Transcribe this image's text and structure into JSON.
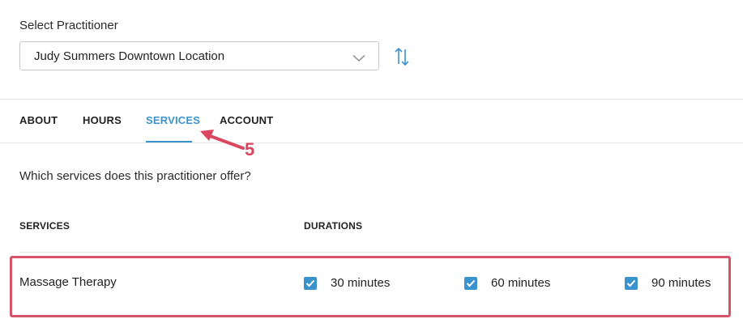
{
  "practitioner": {
    "label": "Select Practitioner",
    "selected": "Judy Summers Downtown Location"
  },
  "tabs": [
    {
      "label": "ABOUT",
      "active": false
    },
    {
      "label": "HOURS",
      "active": false
    },
    {
      "label": "SERVICES",
      "active": true
    },
    {
      "label": "ACCOUNT",
      "active": false
    }
  ],
  "annotation": {
    "number": "5",
    "color": "#d9465e"
  },
  "services_section": {
    "question": "Which services does this practitioner offer?",
    "columns": {
      "services": "SERVICES",
      "durations": "DURATIONS"
    },
    "rows": [
      {
        "name": "Massage Therapy",
        "durations": [
          {
            "label": "30 minutes",
            "checked": true
          },
          {
            "label": "60 minutes",
            "checked": true
          },
          {
            "label": "90 minutes",
            "checked": true
          }
        ]
      }
    ]
  },
  "colors": {
    "accent": "#3a93cc",
    "highlight": "#d65469"
  }
}
